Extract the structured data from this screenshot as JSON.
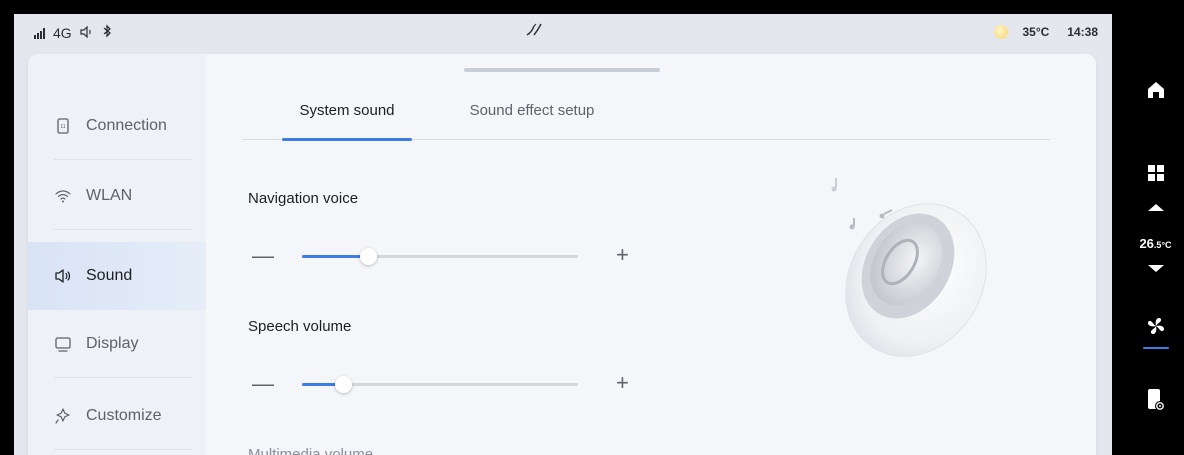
{
  "status_bar": {
    "network": "4G",
    "temperature": "35°C",
    "time": "14:38",
    "icons": [
      "signal-icon",
      "speaker-icon",
      "bluetooth-icon",
      "wiper-icon",
      "weather-sun-icon"
    ]
  },
  "sidebar": {
    "items": [
      {
        "label": "Connection",
        "icon": "phone-icon",
        "active": false
      },
      {
        "label": "WLAN",
        "icon": "wifi-icon",
        "active": false
      },
      {
        "label": "Sound",
        "icon": "speaker-icon",
        "active": true
      },
      {
        "label": "Display",
        "icon": "monitor-icon",
        "active": false
      },
      {
        "label": "Customize",
        "icon": "sparkle-icon",
        "active": false
      }
    ]
  },
  "tabs": [
    {
      "label": "System sound",
      "active": true
    },
    {
      "label": "Sound effect setup",
      "active": false
    }
  ],
  "settings": [
    {
      "label": "Navigation voice",
      "level": 0.24,
      "minus": "—",
      "plus": "+"
    },
    {
      "label": "Speech volume",
      "level": 0.15,
      "minus": "—",
      "plus": "+"
    },
    {
      "label": "Multimedia volume"
    }
  ],
  "rail": {
    "cabin_temperature": "26.5",
    "cabin_temperature_int": "26",
    "cabin_temperature_dec": ".5",
    "cabin_temperature_unit": "°C",
    "icons": [
      "home-icon",
      "apps-grid-icon",
      "chevron-up-icon",
      "chevron-down-icon",
      "fan-icon",
      "phone-settings-icon"
    ]
  },
  "colors": {
    "accent": "#3d7ce6",
    "background": "#e4e8ee",
    "panel": "#f3f5f8",
    "active_nav": "#d8e3f5"
  }
}
